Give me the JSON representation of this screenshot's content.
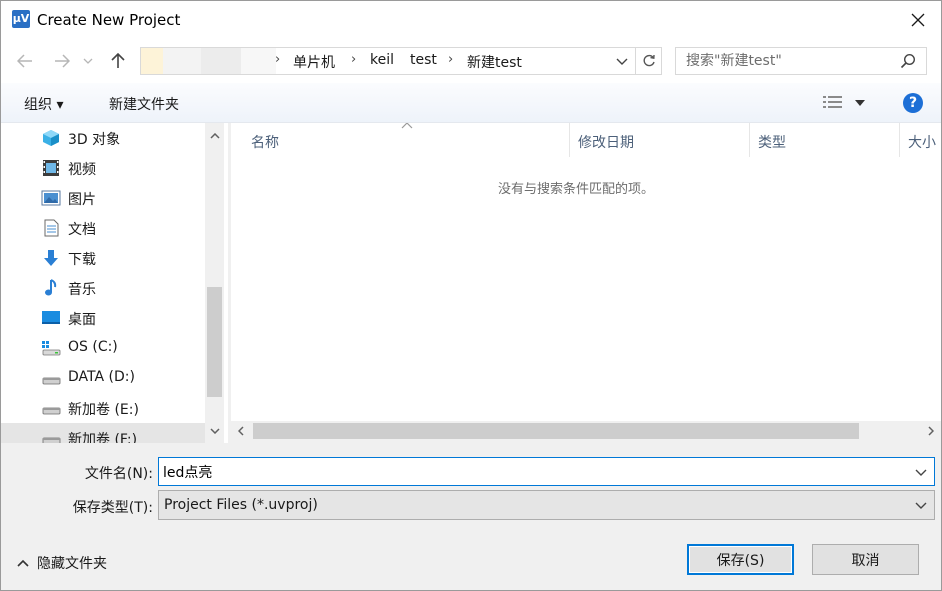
{
  "window": {
    "title": "Create New Project",
    "app_icon_text": "µV"
  },
  "address_bar": {
    "crumbs": [
      "单片机",
      "keil",
      "test",
      "新建test"
    ]
  },
  "search": {
    "placeholder": "搜索\"新建test\""
  },
  "toolbar": {
    "organize_label": "组织 ▾",
    "new_folder_label": "新建文件夹",
    "help_label": "?"
  },
  "nav_pane": {
    "items": [
      {
        "label": "3D 对象",
        "icon": "cube-3d-icon"
      },
      {
        "label": "视频",
        "icon": "video-icon"
      },
      {
        "label": "图片",
        "icon": "picture-icon"
      },
      {
        "label": "文档",
        "icon": "document-icon"
      },
      {
        "label": "下载",
        "icon": "download-icon"
      },
      {
        "label": "音乐",
        "icon": "music-icon"
      },
      {
        "label": "桌面",
        "icon": "desktop-icon"
      },
      {
        "label": "OS (C:)",
        "icon": "system-drive-icon"
      },
      {
        "label": "DATA (D:)",
        "icon": "drive-icon"
      },
      {
        "label": "新加卷 (E:)",
        "icon": "drive-icon"
      },
      {
        "label": "新加卷 (F:)",
        "icon": "drive-icon",
        "selected": true
      }
    ]
  },
  "file_list": {
    "columns": [
      "名称",
      "修改日期",
      "类型",
      "大小"
    ],
    "empty_message": "没有与搜索条件匹配的项。"
  },
  "form": {
    "filename_label": "文件名(N):",
    "filename_value": "led点亮",
    "filetype_label": "保存类型(T):",
    "filetype_value": "Project Files (*.uvproj)"
  },
  "footer": {
    "hide_folders_label": "隐藏文件夹",
    "save_label": "保存(S)",
    "cancel_label": "取消"
  },
  "colors": {
    "accent": "#0078d7",
    "help": "#1d6fd6"
  }
}
